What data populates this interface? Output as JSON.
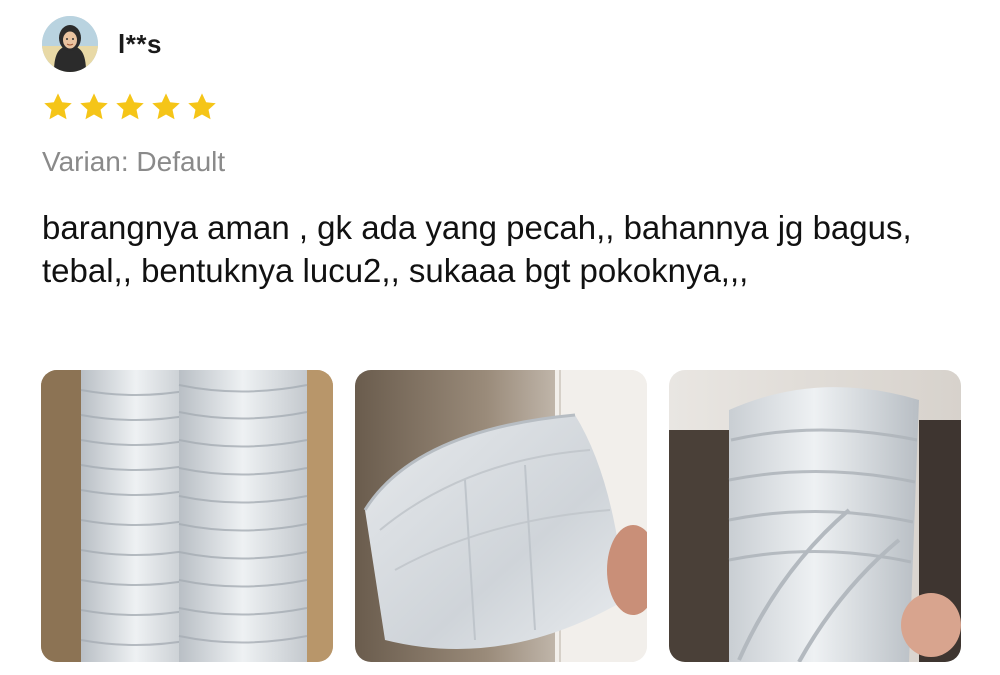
{
  "reviewer": {
    "name": "l**s",
    "avatar_icon": "user-avatar"
  },
  "rating": {
    "value": 5,
    "max": 5,
    "star_color": "#f5c518"
  },
  "variant": "Varian: Default",
  "review_text": "barangnya aman , gk ada yang pecah,, bahannya jg bagus, tebal,, bentuknya lucu2,, sukaaa bgt pokoknya,,,",
  "photos": [
    {
      "icon": "stacked-plastic-pots-photo"
    },
    {
      "icon": "plastic-pot-in-hand-photo"
    },
    {
      "icon": "plastic-pot-closeup-photo"
    }
  ]
}
